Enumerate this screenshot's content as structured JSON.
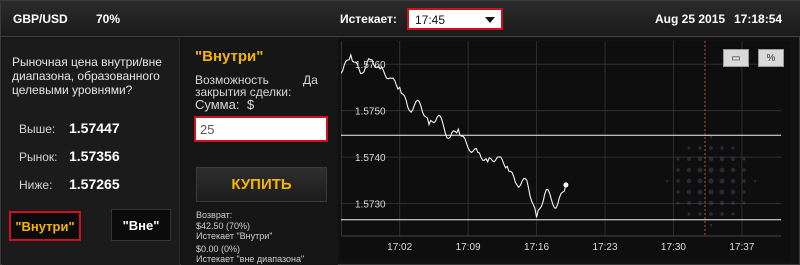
{
  "header": {
    "asset": "GBP/USD",
    "percent": "70%",
    "expiry_label": "Истекает:",
    "expiry_value": "17:45",
    "date": "Aug 25 2015",
    "time": "17:18:54"
  },
  "left_panel": {
    "question": "Рыночная цена внутри/вне диапазона, образованного целевыми уровнями?",
    "rows": [
      {
        "label": "Выше:",
        "value": "1.57447"
      },
      {
        "label": "Рынок:",
        "value": "1.57356"
      },
      {
        "label": "Ниже:",
        "value": "1.57265"
      }
    ],
    "inside_button": "\"Внутри\"",
    "outside_button": "\"Вне\""
  },
  "trade_panel": {
    "mode_title": "\"Внутри\"",
    "early_close_label": "Возможность закрытия сделки:",
    "early_close_value": "Да",
    "amount_label": "Сумма:",
    "currency": "$",
    "amount_value": "25",
    "buy_button": "КУПИТЬ",
    "payout_lines": [
      "Возврат:",
      "$42.50 (70%)",
      "Истекает \"Внутри\"",
      "$0.00 (0%)",
      "Истекает \"вне диапазона\""
    ]
  },
  "chart_data": {
    "type": "line",
    "y_ticks": [
      "1.5760",
      "1.5750",
      "1.5740",
      "1.5730"
    ],
    "x_ticks": [
      "17:02",
      "17:09",
      "17:16",
      "17:23",
      "17:30",
      "17:37"
    ],
    "ylim": [
      1.5723,
      1.5765
    ],
    "upper_level": 1.57447,
    "lower_level": 1.57265,
    "expiry_marker": "17:45",
    "series": [
      {
        "points": [
          [
            "16:56",
            1.5758
          ],
          [
            "16:57",
            1.5762
          ],
          [
            "16:58",
            1.5758
          ],
          [
            "16:59",
            1.5761
          ],
          [
            "17:00",
            1.5759
          ],
          [
            "17:01",
            1.5757
          ],
          [
            "17:02",
            1.5755
          ],
          [
            "17:03",
            1.575
          ],
          [
            "17:04",
            1.5752
          ],
          [
            "17:05",
            1.5747
          ],
          [
            "17:06",
            1.5749
          ],
          [
            "17:07",
            1.5744
          ],
          [
            "17:08",
            1.5746
          ],
          [
            "17:09",
            1.5742
          ],
          [
            "17:10",
            1.5741
          ],
          [
            "17:11",
            1.5739
          ],
          [
            "17:12",
            1.574
          ],
          [
            "17:13",
            1.5738
          ],
          [
            "17:14",
            1.5734
          ],
          [
            "17:15",
            1.5735
          ],
          [
            "17:16",
            1.5727
          ],
          [
            "17:17",
            1.5733
          ],
          [
            "17:18",
            1.5729
          ],
          [
            "17:19",
            1.5734
          ]
        ]
      }
    ],
    "grid": true
  },
  "colors": {
    "accent": "#f5b400",
    "highlight": "#d0101e",
    "marker": "#c0502a"
  },
  "icons": {
    "chart_type_icon": "candles-icon",
    "percent_icon": "percent-icon"
  }
}
